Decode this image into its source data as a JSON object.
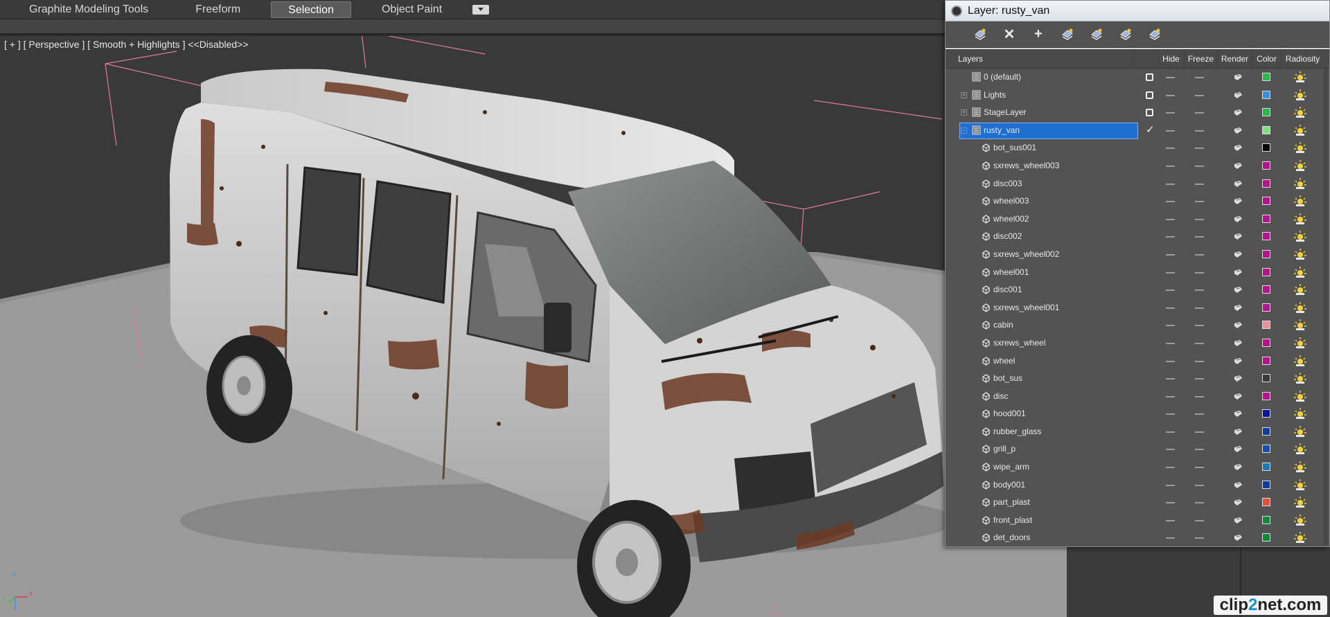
{
  "ribbon": {
    "tabs": [
      {
        "label": "Graphite Modeling Tools",
        "active": false
      },
      {
        "label": "Freeform",
        "active": false
      },
      {
        "label": "Selection",
        "active": true
      },
      {
        "label": "Object Paint",
        "active": false
      }
    ]
  },
  "viewport": {
    "label": "[ + ] [ Perspective ] [ Smooth + Highlights ] <<Disabled>>",
    "axis": {
      "x": "x",
      "y": "y",
      "z": "z"
    }
  },
  "layer_dialog": {
    "title": "Layer: rusty_van",
    "toolbar": [
      {
        "name": "create-layer-icon"
      },
      {
        "name": "delete-layer-icon",
        "glyph": "✕"
      },
      {
        "name": "add-to-layer-icon",
        "glyph": "+"
      },
      {
        "name": "select-in-layer-icon"
      },
      {
        "name": "highlight-layer-icon"
      },
      {
        "name": "hide-all-icon"
      },
      {
        "name": "freeze-all-icon"
      }
    ],
    "columns": {
      "layers": "Layers",
      "hide": "Hide",
      "freeze": "Freeze",
      "render": "Render",
      "color": "Color",
      "radiosity": "Radiosity"
    },
    "layers": [
      {
        "name": "0 (default)",
        "type": "layer",
        "expandable": false,
        "color": "#2bb54a",
        "active_box": true
      },
      {
        "name": "Lights",
        "type": "layer",
        "expandable": true,
        "color": "#3a8fe0",
        "active_box": true
      },
      {
        "name": "StageLayer",
        "type": "layer",
        "expandable": true,
        "color": "#2bb54a",
        "active_box": true
      },
      {
        "name": "rusty_van",
        "type": "layer",
        "expandable": true,
        "expanded": true,
        "selected": true,
        "current": true,
        "color": "#7fe07f"
      }
    ],
    "objects": [
      {
        "name": "bot_sus001",
        "color": "#050505"
      },
      {
        "name": "sxrews_wheel003",
        "color": "#b0158f"
      },
      {
        "name": "disc003",
        "color": "#b0158f"
      },
      {
        "name": "wheel003",
        "color": "#b0158f"
      },
      {
        "name": "wheel002",
        "color": "#b0158f"
      },
      {
        "name": "disc002",
        "color": "#b0158f"
      },
      {
        "name": "sxrews_wheel002",
        "color": "#b0158f"
      },
      {
        "name": "wheel001",
        "color": "#b0158f"
      },
      {
        "name": "disc001",
        "color": "#b0158f"
      },
      {
        "name": "sxrews_wheel001",
        "color": "#b0158f"
      },
      {
        "name": "cabin",
        "color": "#e8909a"
      },
      {
        "name": "sxrews_wheel",
        "color": "#b0158f"
      },
      {
        "name": "wheel",
        "color": "#b0158f"
      },
      {
        "name": "bot_sus",
        "color": "#3a3a3a"
      },
      {
        "name": "disc",
        "color": "#b0158f"
      },
      {
        "name": "hood001",
        "color": "#0d1590"
      },
      {
        "name": "rubber_glass",
        "color": "#0d3f9a"
      },
      {
        "name": "grill_p",
        "color": "#1450a8"
      },
      {
        "name": "wipe_arm",
        "color": "#1a7ab8"
      },
      {
        "name": "body001",
        "color": "#0d3f9a"
      },
      {
        "name": "part_plast",
        "color": "#e0503c"
      },
      {
        "name": "front_plast",
        "color": "#0e8a3a"
      },
      {
        "name": "det_doors",
        "color": "#0e8a3a"
      }
    ]
  },
  "watermark": {
    "pre": "clip",
    "two": "2",
    "post": "net.com"
  }
}
